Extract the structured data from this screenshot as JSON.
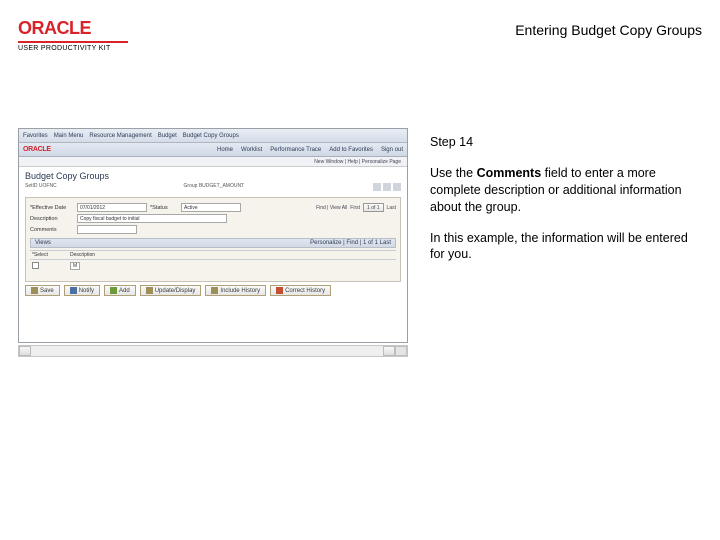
{
  "header": {
    "logo_text": "ORACLE",
    "logo_sub": "USER PRODUCTIVITY KIT",
    "page_title": "Entering Budget Copy Groups"
  },
  "instructions": {
    "step_label": "Step 14",
    "p1_a": "Use the ",
    "p1_bold": "Comments",
    "p1_b": " field to enter a more complete description or additional information about the group.",
    "p2": "In this example, the information will be entered for you."
  },
  "screenshot": {
    "menu": {
      "m1": "Favorites",
      "m2": "Main Menu",
      "m3": "Resource Management",
      "m4": "Budget",
      "m5": "Budget Copy Groups"
    },
    "top2": {
      "oracle": "ORACLE",
      "home": "Home",
      "worklist": "Worklist",
      "perf": "Performance Trace",
      "addfav": "Add to Favorites",
      "signout": "Sign out"
    },
    "crumb": "New Window | Help | Personalize Page",
    "page_title": "Budget Copy Groups",
    "meta_left": "SetID  UOFNC",
    "meta_right": "Group  BUDGET_AMOUNT",
    "label_eff": "*Effective Date",
    "val_eff": "07/01/2012",
    "label_status": "*Status",
    "val_status": "Active",
    "find": "Find | View All",
    "first": "First",
    "pager": "1 of 1",
    "last": "Last",
    "label_desc": "Description",
    "val_desc": "Copy fiscal budget to initial",
    "label_comments": "Comments",
    "views_title": "Views",
    "find2": "Personalize | Find |",
    "pager2": "1 of 1",
    "last2": "Last",
    "col_select": "*Select",
    "col_desc": "Description",
    "cell_val": "M",
    "toolbar": {
      "save": "Save",
      "notify": "Notify",
      "add": "Add",
      "update": "Update/Display",
      "history": "Include History",
      "correct": "Correct History"
    }
  }
}
